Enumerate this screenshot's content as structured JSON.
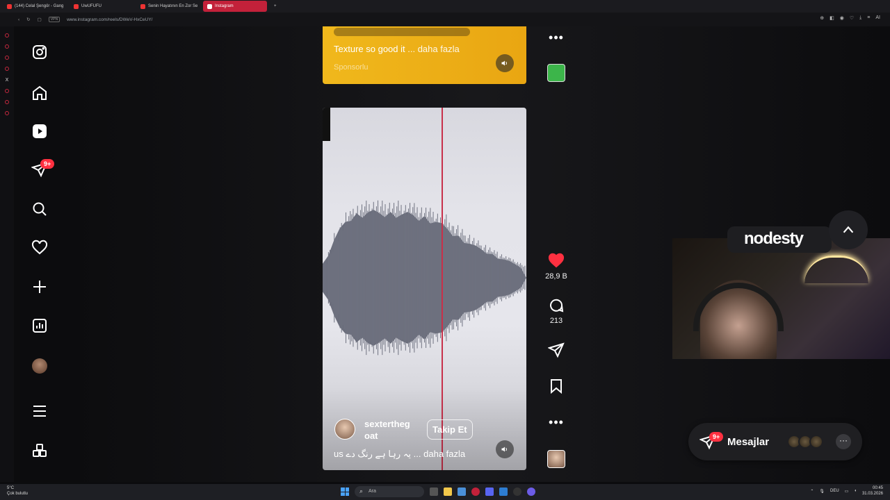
{
  "browser": {
    "tabs": [
      {
        "title": "(144) Celal Şengör - Gang"
      },
      {
        "title": "UwUFUFU"
      },
      {
        "title": "Senin Hayatının En Zor Se"
      },
      {
        "title": "Instagram",
        "active": true
      }
    ],
    "new_tab": "+",
    "url": "www.instagram.com/reels/DWeV-HxCeUY/",
    "vpn": "VPN",
    "ai_label": "AI"
  },
  "sidebar": {
    "notification_badge": "9+"
  },
  "reel_top": {
    "caption": "Texture so good it",
    "more": "... daha fazla",
    "sponsored": "Sponsorlu"
  },
  "reel": {
    "username": "sextertheg oat",
    "follow": "Takip Et",
    "caption": "us یہ رہا ہے رنگ دے ...",
    "more": "daha fazla"
  },
  "actions": {
    "likes": "28,9 B",
    "comments": "213"
  },
  "overlay": {
    "logo": "nodesty"
  },
  "messages": {
    "badge": "9+",
    "label": "Mesajlar"
  },
  "taskbar": {
    "temperature": "5°C",
    "weather": "Çok bulutlu",
    "search": "Ara",
    "language": "DEU",
    "time": "00:45",
    "date": "31.03.2026"
  },
  "colors": {
    "accent_red": "#ff3040",
    "like_heart": "#ff3040",
    "sponsor_bg": "#f0b81c",
    "tab_active": "#c3213a"
  },
  "waveform": {
    "levels": [
      0.2,
      0.35,
      0.55,
      0.7,
      0.82,
      0.9,
      0.92,
      0.95,
      0.96,
      0.97,
      0.95,
      0.96,
      0.94,
      0.95,
      0.93,
      0.94,
      0.92,
      0.9,
      0.88,
      0.86,
      0.82,
      0.78,
      0.72,
      0.66,
      0.6,
      0.55,
      0.5,
      0.46,
      0.42,
      0.38,
      0.34,
      0.3,
      0.27,
      0.24,
      0.2,
      0.16
    ]
  }
}
